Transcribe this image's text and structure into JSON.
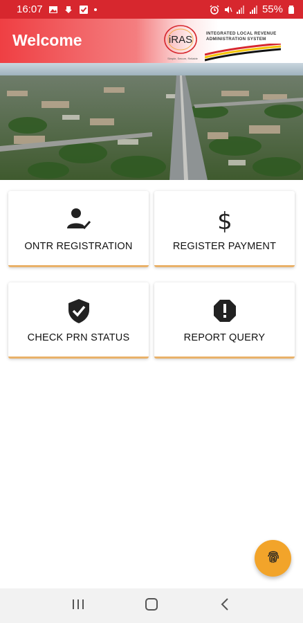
{
  "status_bar": {
    "time": "16:07",
    "battery": "55%",
    "color": "#d7272e"
  },
  "header": {
    "title": "Welcome",
    "logo_text": "iRAS",
    "org_name": "INTEGRATED LOCAL REVENUE ADMINISTRATION SYSTEM",
    "tagline": "Simple, Secure, Reliable",
    "gradient_start": "#ef3f43"
  },
  "cards": [
    {
      "label": "ONTR REGISTRATION",
      "icon": "person-check-icon"
    },
    {
      "label": "REGISTER PAYMENT",
      "icon": "dollar-icon"
    },
    {
      "label": "CHECK PRN STATUS",
      "icon": "shield-check-icon"
    },
    {
      "label": "REPORT QUERY",
      "icon": "alert-circle-icon"
    }
  ],
  "card_accent": "#e9b169",
  "fab": {
    "icon": "fingerprint-icon",
    "color": "#f2a42a"
  },
  "nav": {
    "recents": "recents-icon",
    "home": "home-icon",
    "back": "back-icon"
  }
}
